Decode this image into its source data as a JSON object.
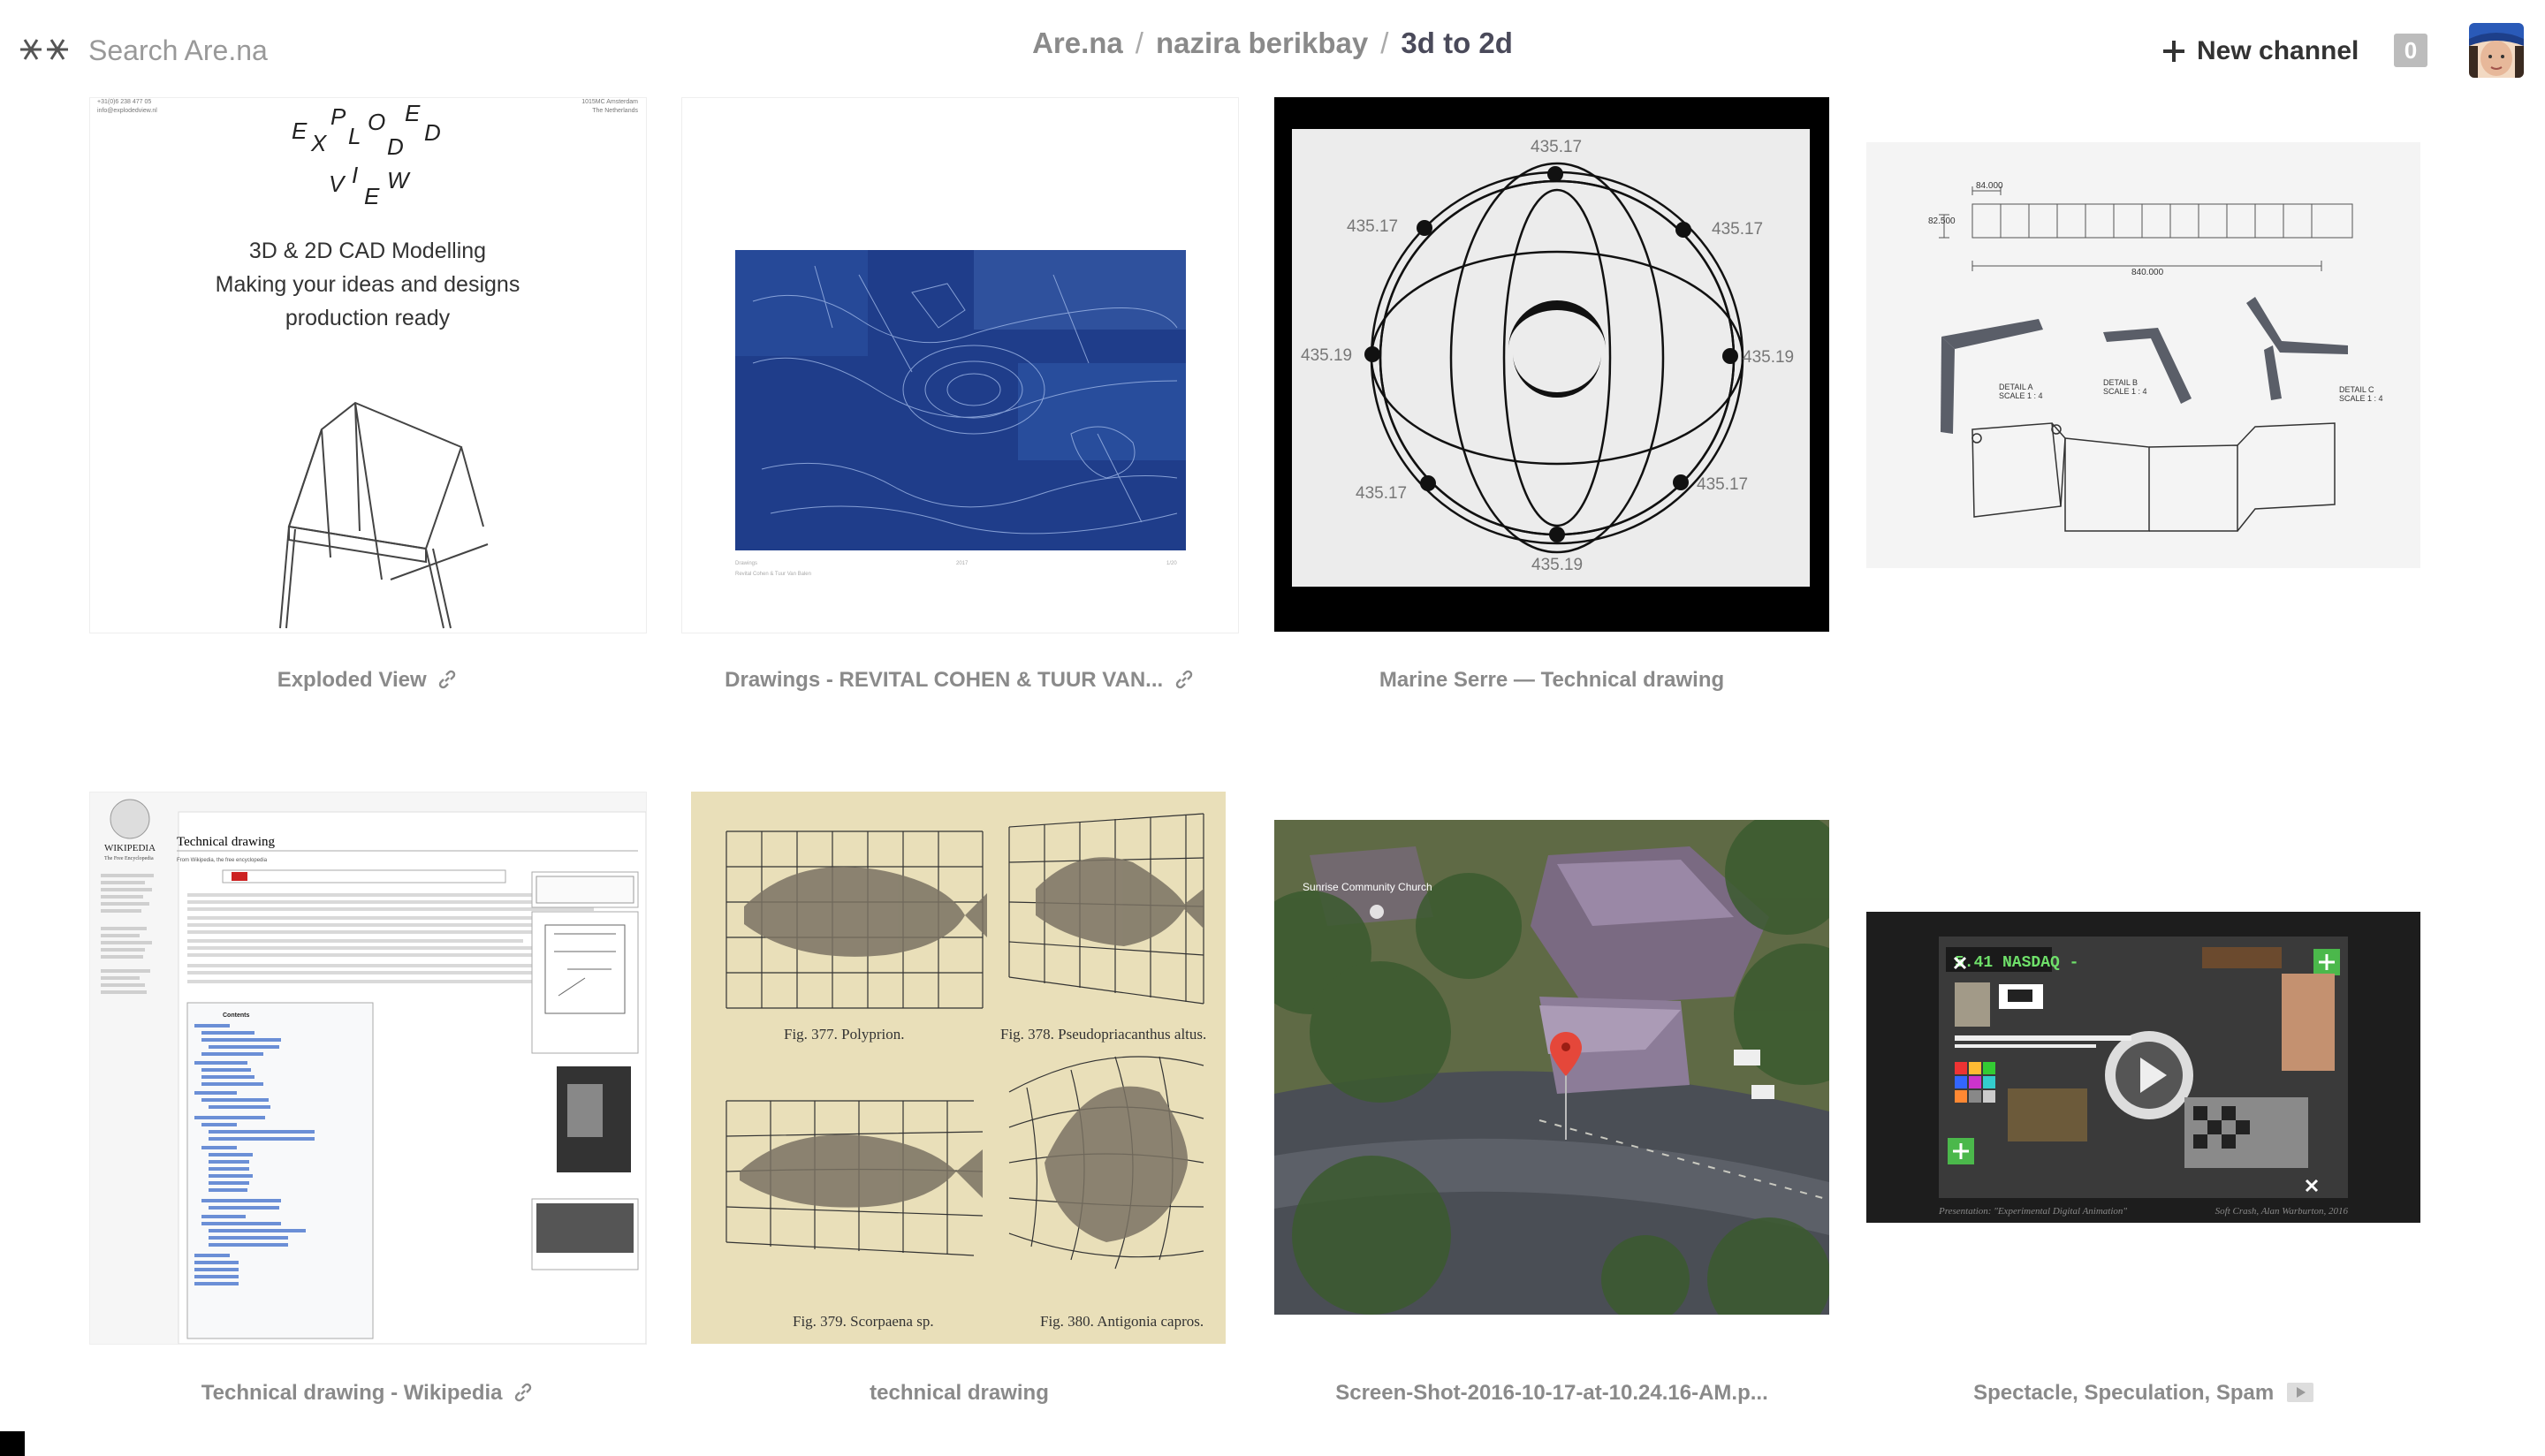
{
  "search": {
    "placeholder": "Search Are.na"
  },
  "breadcrumb": {
    "site": "Are.na",
    "user": "nazira berikbay",
    "channel": "3d to 2d",
    "separator": "/"
  },
  "header": {
    "new_channel_label": "New channel",
    "notification_count": "0"
  },
  "blocks": [
    {
      "caption": "Exploded View",
      "has_link_icon": true
    },
    {
      "caption": "Drawings - REVITAL COHEN & TUUR VAN...",
      "has_link_icon": true
    },
    {
      "caption": "Marine Serre — Technical drawing",
      "has_link_icon": false
    },
    {
      "caption": "",
      "has_link_icon": false
    },
    {
      "caption": "Technical drawing - Wikipedia",
      "has_link_icon": true
    },
    {
      "caption": "technical drawing",
      "has_link_icon": false
    },
    {
      "caption": "Screen-Shot-2016-10-17-at-10.24.16-AM.p...",
      "has_link_icon": false
    },
    {
      "caption": "Spectacle, Speculation, Spam",
      "has_media_icon": true
    }
  ],
  "exploded_view_image": {
    "contact_left_1": "+31(0)6 238 477 05",
    "contact_left_2": "info@explodedview.nl",
    "contact_right_1": "1015MC Amsterdam",
    "contact_right_2": "The Netherlands",
    "tagline_1": "3D & 2D CAD Modelling",
    "tagline_2": "Making your ideas and designs",
    "tagline_3": "production ready"
  },
  "marine_serre_image": {
    "labels": [
      "435.17",
      "435.17",
      "435.17",
      "435.19",
      "435.19",
      "435.17",
      "435.17",
      "435.19"
    ]
  },
  "cad_image": {
    "dim_top": "84.000",
    "dim_side": "82.500",
    "dim_width": "840.000",
    "detail_a": "DETAIL A\nSCALE 1 : 4",
    "detail_b": "DETAIL B\nSCALE 1 : 4",
    "detail_c": "DETAIL C\nSCALE 1 : 4"
  },
  "wikipedia_image": {
    "logo_text": "WIKIPEDIA",
    "logo_sub": "The Free Encyclopedia",
    "title": "Technical drawing",
    "from": "From Wikipedia, the free encyclopedia",
    "contents": "Contents"
  },
  "fish_image": {
    "fig_377": "Fig. 377. Polyprion.",
    "fig_378": "Fig. 378. Pseudopriacanthus altus.",
    "fig_379": "Fig. 379. Scorpaena sp.",
    "fig_380": "Fig. 380. Antigonia capros."
  },
  "map_image": {
    "place_label": "Sunrise Community Church"
  },
  "spam_image": {
    "ticker": "5.41 NASDAQ -",
    "footer_left": "Presentation: \"Experimental Digital Animation\"",
    "footer_right": "Soft Crash, Alan Warburton, 2016"
  },
  "colors": {
    "caption_gray": "#8a8a8a",
    "blueprint": "#1f3d8a",
    "fish_paper": "#e9dfb9"
  }
}
